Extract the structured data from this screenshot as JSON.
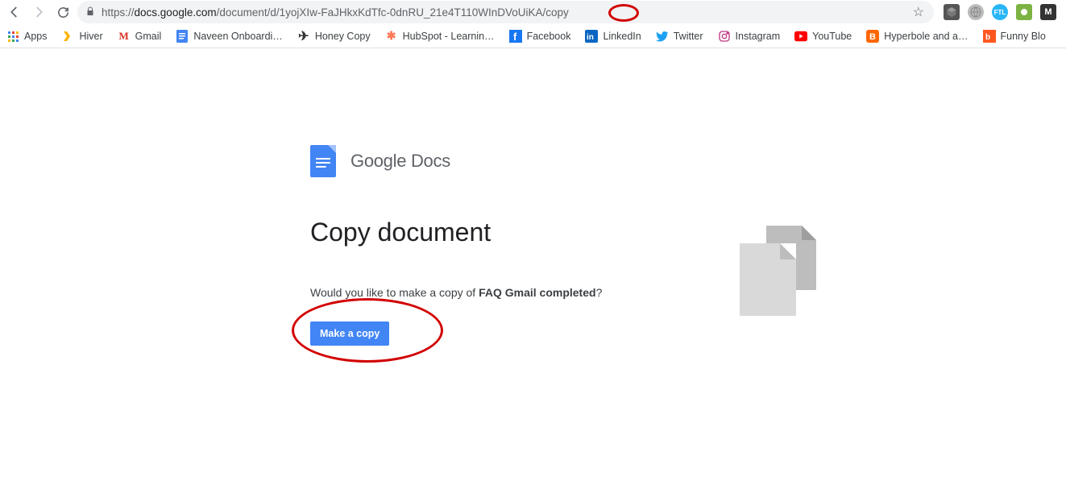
{
  "nav": {
    "url_prefix": "https://",
    "url_host": "docs.google.com",
    "url_path": "/document/d/1yojXIw-FaJHkxKdTfc-0dnRU_21e4T110WInDVoUiKA/copy"
  },
  "bookmarks": [
    {
      "label": "Apps",
      "icon": "bm-apps"
    },
    {
      "label": "Hiver",
      "icon": "bm-hiver"
    },
    {
      "label": "Gmail",
      "icon": "bm-gmail"
    },
    {
      "label": "Naveen Onboardi…",
      "icon": "bm-docs"
    },
    {
      "label": "Honey Copy",
      "icon": "bm-honey"
    },
    {
      "label": "HubSpot - Learnin…",
      "icon": "bm-hubspot"
    },
    {
      "label": "Facebook",
      "icon": "bm-fb"
    },
    {
      "label": "LinkedIn",
      "icon": "bm-in"
    },
    {
      "label": "Twitter",
      "icon": "bm-tw"
    },
    {
      "label": "Instagram",
      "icon": "bm-ig"
    },
    {
      "label": "YouTube",
      "icon": "bm-yt"
    },
    {
      "label": "Hyperbole and a…",
      "icon": "bm-bl"
    },
    {
      "label": "Funny Blo",
      "icon": "bm-fb2"
    }
  ],
  "brand": {
    "g": "G",
    "oogle": "oogle",
    "docs": " Docs"
  },
  "page": {
    "heading": "Copy document",
    "prompt_pre": "Would you like to make a copy of ",
    "doc_name": "FAQ Gmail completed",
    "prompt_post": "?",
    "button": "Make a copy"
  }
}
